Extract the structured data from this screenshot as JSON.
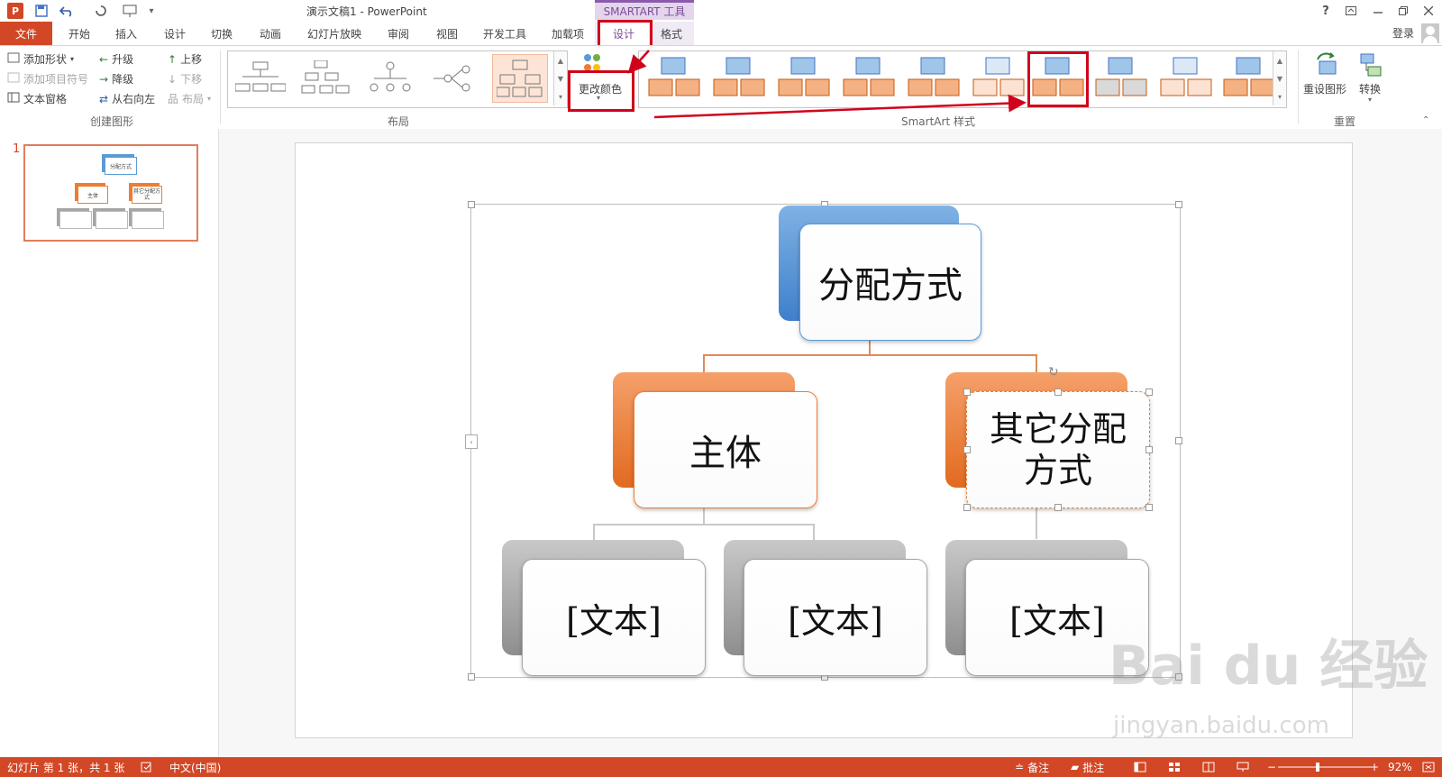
{
  "window": {
    "app_logo": "P",
    "title": "演示文稿1 - PowerPoint",
    "context_group": "SMARTART 工具",
    "help": "?",
    "login": "登录"
  },
  "tabs": [
    "文件",
    "开始",
    "插入",
    "设计",
    "切换",
    "动画",
    "幻灯片放映",
    "审阅",
    "视图",
    "开发工具",
    "加载项",
    "设计",
    "格式"
  ],
  "ribbon": {
    "create": {
      "add_shape": "添加形状",
      "add_bullet": "添加项目符号",
      "text_pane": "文本窗格",
      "promote": "升级",
      "demote": "降级",
      "right_to_left": "从右向左",
      "move_up": "上移",
      "move_down": "下移",
      "layout": "布局",
      "group_label": "创建图形"
    },
    "layouts": {
      "group_label": "布局"
    },
    "change_colors": "更改颜色",
    "styles": {
      "group_label": "SmartArt 样式"
    },
    "reset": {
      "reset_graphic": "重设图形",
      "convert": "转换",
      "group_label": "重置"
    }
  },
  "slides_pane": {
    "slide_number": "1",
    "thumb_texts": [
      "分配方式",
      "主体",
      "其它分配方式"
    ]
  },
  "smartart": {
    "top": "分配方式",
    "mid_left": "主体",
    "mid_right_line1": "其它分配",
    "mid_right_line2": "方式",
    "bottom": [
      "[文本]",
      "[文本]",
      "[文本]"
    ]
  },
  "status": {
    "slide_info": "幻灯片 第 1 张，共 1 张",
    "language": "中文(中国)",
    "notes": "备注",
    "comments": "批注",
    "zoom": "92%"
  },
  "watermark": {
    "brand": "Bai du 经验",
    "url": "jingyan.baidu.com"
  },
  "colors": {
    "accent": "#d24726",
    "blue": "#5b9bd5",
    "orange": "#ed7d31",
    "gray": "#a5a5a5",
    "annotation": "#d0021b"
  }
}
